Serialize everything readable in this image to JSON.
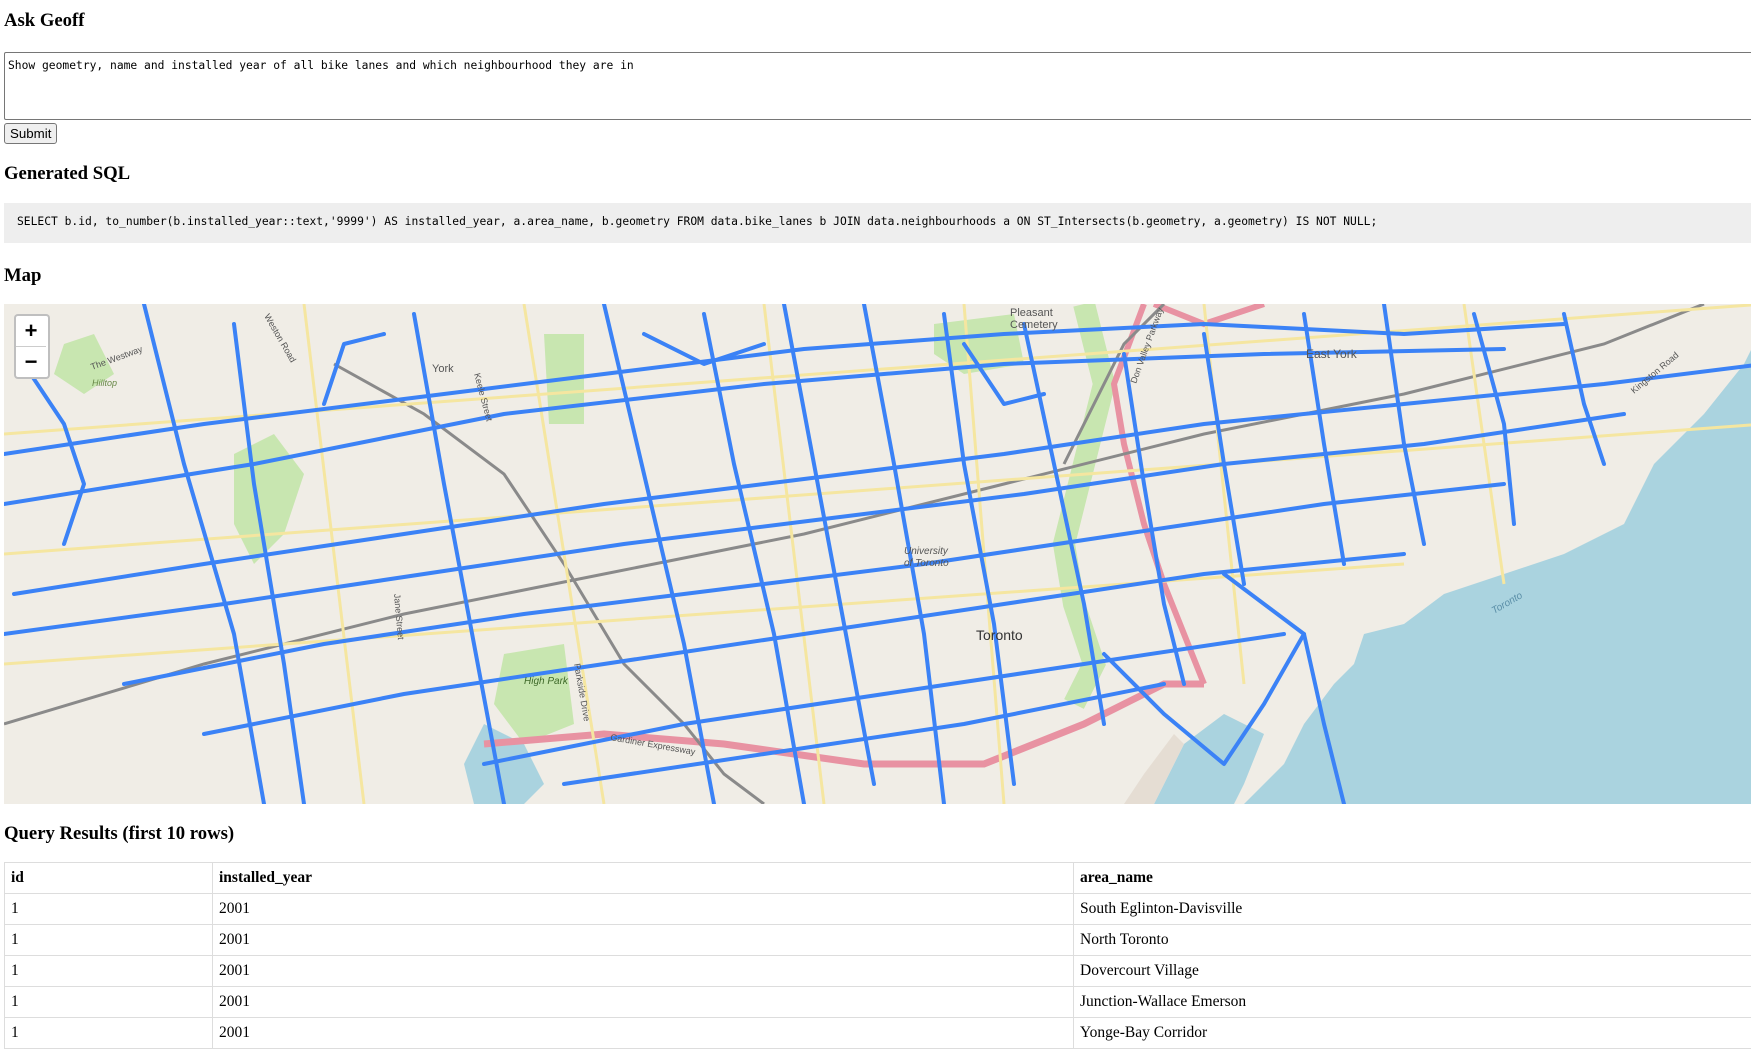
{
  "ask": {
    "title": "Ask Geoff",
    "question": "Show geometry, name and installed year of all bike lanes and which neighbourhood they are in",
    "submit_label": "Submit"
  },
  "sql": {
    "title": "Generated SQL",
    "query": "SELECT b.id, to_number(b.installed_year::text,'9999') AS installed_year, a.area_name, b.geometry FROM data.bike_lanes b JOIN data.neighbourhoods a ON ST_Intersects(b.geometry, a.geometry) IS NOT NULL;"
  },
  "map": {
    "title": "Map",
    "zoom_in": "+",
    "zoom_out": "−",
    "labels": {
      "pleasant": "Pleasant",
      "cemetery": "Cemetery",
      "york": "York",
      "east_york": "East York",
      "the_westway": "The Westway",
      "hilltop": "Hilltop",
      "weston_road": "Weston Road",
      "keele_street": "Keele Street",
      "kingston_road": "Kingston Road",
      "university": "University",
      "of_toronto": "of Toronto",
      "toronto": "Toronto",
      "high_park": "High Park",
      "parkside_drive": "Parkside Drive",
      "jane_street": "Jane Street",
      "gardiner": "Gardiner Expressway",
      "don_valley_parkway": "Don Valley Parkway",
      "toronto_lake": "Toronto"
    },
    "colors": {
      "land": "#f0ede6",
      "water": "#aad3df",
      "bike_lane": "#3b82f6",
      "park": "#c8e6b0",
      "highway": "#e892a2"
    }
  },
  "results": {
    "title": "Query Results (first 10 rows)",
    "columns": [
      "id",
      "installed_year",
      "area_name"
    ],
    "rows": [
      [
        "1",
        "2001",
        "South Eglinton-Davisville"
      ],
      [
        "1",
        "2001",
        "North Toronto"
      ],
      [
        "1",
        "2001",
        "Dovercourt Village"
      ],
      [
        "1",
        "2001",
        "Junction-Wallace Emerson"
      ],
      [
        "1",
        "2001",
        "Yonge-Bay Corridor"
      ]
    ]
  }
}
